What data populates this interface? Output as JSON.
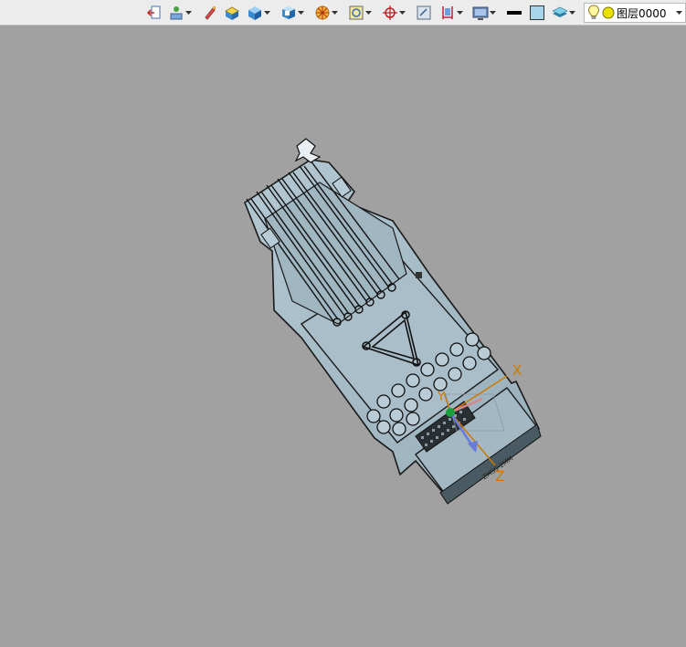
{
  "toolbar": {
    "items": [
      {
        "name": "exit-sketch-icon",
        "has_menu": false
      },
      {
        "name": "render-mode-icon",
        "has_menu": true
      },
      {
        "name": "brush-icon",
        "has_menu": false
      },
      {
        "name": "material-icon",
        "has_menu": false
      },
      {
        "name": "solid-box-icon",
        "has_menu": true
      },
      {
        "name": "section-view-icon",
        "has_menu": true
      },
      {
        "name": "light-icon",
        "has_menu": true
      },
      {
        "name": "view-orient-icon",
        "has_menu": true
      },
      {
        "name": "rotate-view-icon",
        "has_menu": true
      },
      {
        "name": "zoom-window-icon",
        "has_menu": false
      },
      {
        "name": "dimension-icon",
        "has_menu": true
      },
      {
        "name": "display-icon",
        "has_menu": true
      },
      {
        "name": "line-weight-icon",
        "has_menu": false
      },
      {
        "name": "color-swatch-icon",
        "has_menu": false
      },
      {
        "name": "layer-manager-icon",
        "has_menu": true
      }
    ],
    "layer": {
      "name": "图层0000",
      "bulb_icon": "lightbulb-icon",
      "state_icon": "layer-on-icon",
      "state_color": "#e8e000"
    }
  },
  "viewport": {
    "background": "#a1a1a1",
    "model_color": "#a7bcc6",
    "triad": {
      "x_label": "X",
      "y_label": "Y",
      "z_label": "Z",
      "label_color": "#cc7a00"
    },
    "part_text": "ZMSS-2MM"
  }
}
